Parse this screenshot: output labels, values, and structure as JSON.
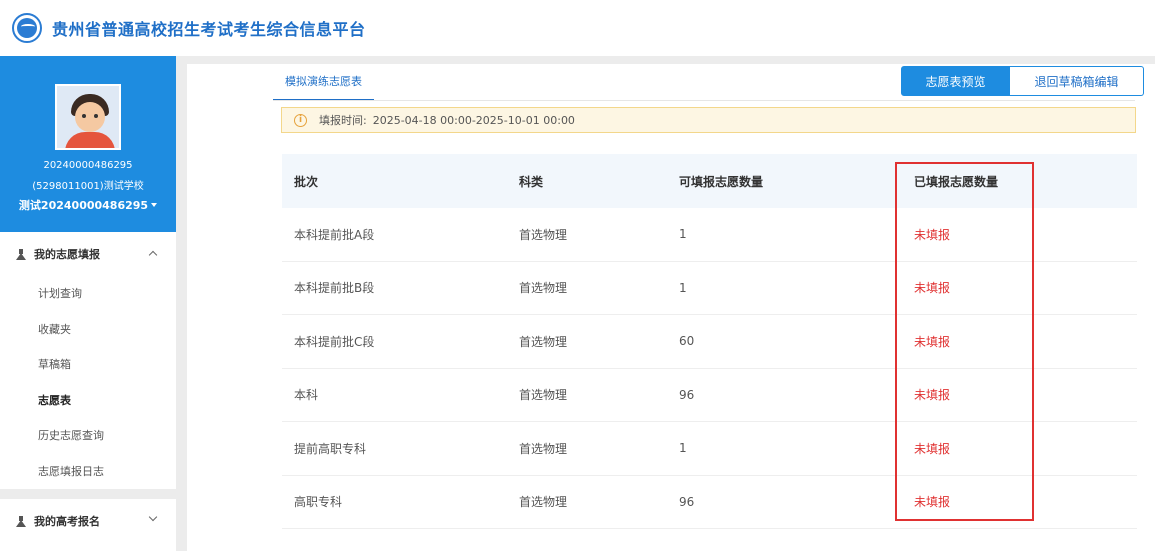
{
  "header": {
    "site_title": "贵州省普通高校招生考试考生综合信息平台"
  },
  "profile": {
    "id": "20240000486295",
    "school": "(5298011001)测试学校",
    "name": "测试20240000486295"
  },
  "sidebar": {
    "group1": {
      "label": "我的志愿填报"
    },
    "items": [
      {
        "label": "计划查询"
      },
      {
        "label": "收藏夹"
      },
      {
        "label": "草稿箱"
      },
      {
        "label": "志愿表"
      },
      {
        "label": "历史志愿查询"
      },
      {
        "label": "志愿填报日志"
      }
    ],
    "group2": {
      "label": "我的高考报名"
    }
  },
  "main": {
    "tab_label": "模拟演练志愿表",
    "btn_preview": "志愿表预览",
    "btn_return": "退回草稿箱编辑",
    "notice_label": "填报时间:",
    "notice_time": "2025-04-18 00:00-2025-10-01 00:00",
    "table": {
      "headers": [
        "批次",
        "科类",
        "可填报志愿数量",
        "已填报志愿数量"
      ],
      "rows": [
        {
          "batch": "本科提前批A段",
          "category": "首选物理",
          "count": "1",
          "status": "未填报"
        },
        {
          "batch": "本科提前批B段",
          "category": "首选物理",
          "count": "1",
          "status": "未填报"
        },
        {
          "batch": "本科提前批C段",
          "category": "首选物理",
          "count": "60",
          "status": "未填报"
        },
        {
          "batch": "本科",
          "category": "首选物理",
          "count": "96",
          "status": "未填报"
        },
        {
          "batch": "提前高职专科",
          "category": "首选物理",
          "count": "1",
          "status": "未填报"
        },
        {
          "batch": "高职专科",
          "category": "首选物理",
          "count": "96",
          "status": "未填报"
        }
      ]
    }
  },
  "colors": {
    "primary": "#1e8ce0",
    "status_red": "#e03131",
    "highlight": "#e03131"
  }
}
